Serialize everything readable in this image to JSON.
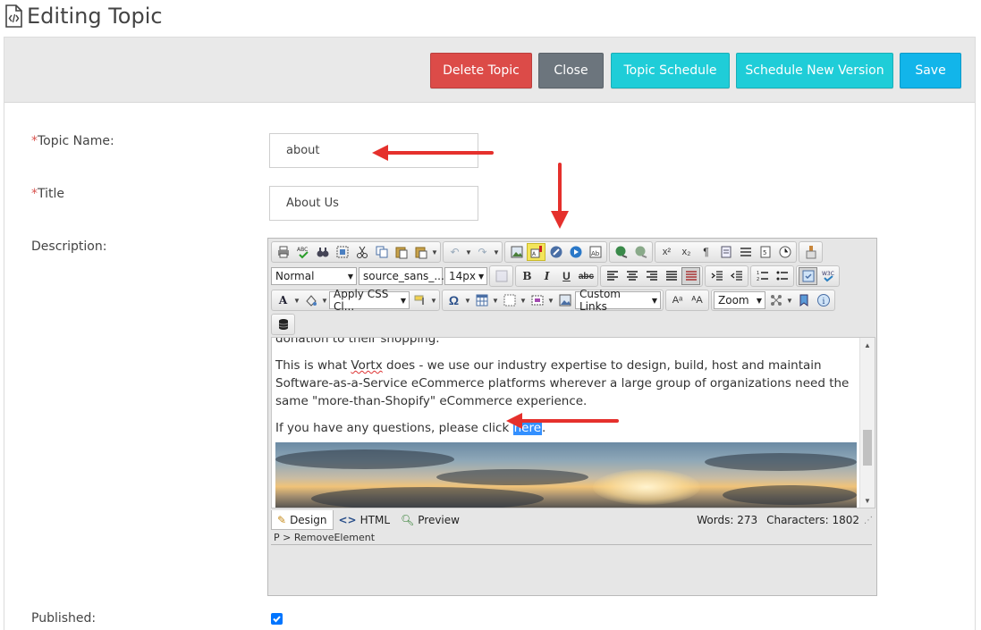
{
  "page": {
    "title": "Editing Topic"
  },
  "actions": {
    "delete_label": "Delete Topic",
    "close_label": "Close",
    "schedule_label": "Topic Schedule",
    "new_version_label": "Schedule New Version",
    "save_label": "Save"
  },
  "form": {
    "topic_name_required": "*",
    "topic_name_label": "Topic Name:",
    "topic_name_value": "about",
    "title_required": "*",
    "title_label": "Title",
    "title_value": "About Us",
    "description_label": "Description:",
    "published_label": "Published:",
    "published_checked": true
  },
  "editor": {
    "format_select": "Normal",
    "font_select": "source_sans_...",
    "size_select": "14px",
    "css_class_select": "Apply CSS Cl...",
    "custom_links_select": "Custom Links",
    "zoom_select": "Zoom",
    "content": {
      "p0": "donation to their shopping.",
      "p1_a": "This is what ",
      "p1_brand": "Vortx",
      "p1_b": " does - we use our industry expertise to design, build, host and maintain Software-as-a-Service eCommerce platforms wherever a large group of organizations need the same \"more-than-Shopify\" eCommerce experience.",
      "p2_a": "If you have any questions, please click ",
      "p2_link": "here",
      "p2_b": "."
    },
    "modes": {
      "design": "Design",
      "html": "HTML",
      "preview": "Preview"
    },
    "words": "Words: 273",
    "characters": "Characters: 1802",
    "path": "P > RemoveElement"
  },
  "colors": {
    "delete": "#dc4b48",
    "close": "#6c757d",
    "schedule": "#1fcdd8",
    "save": "#12b5ea",
    "annotation_arrow": "#e5302c"
  }
}
